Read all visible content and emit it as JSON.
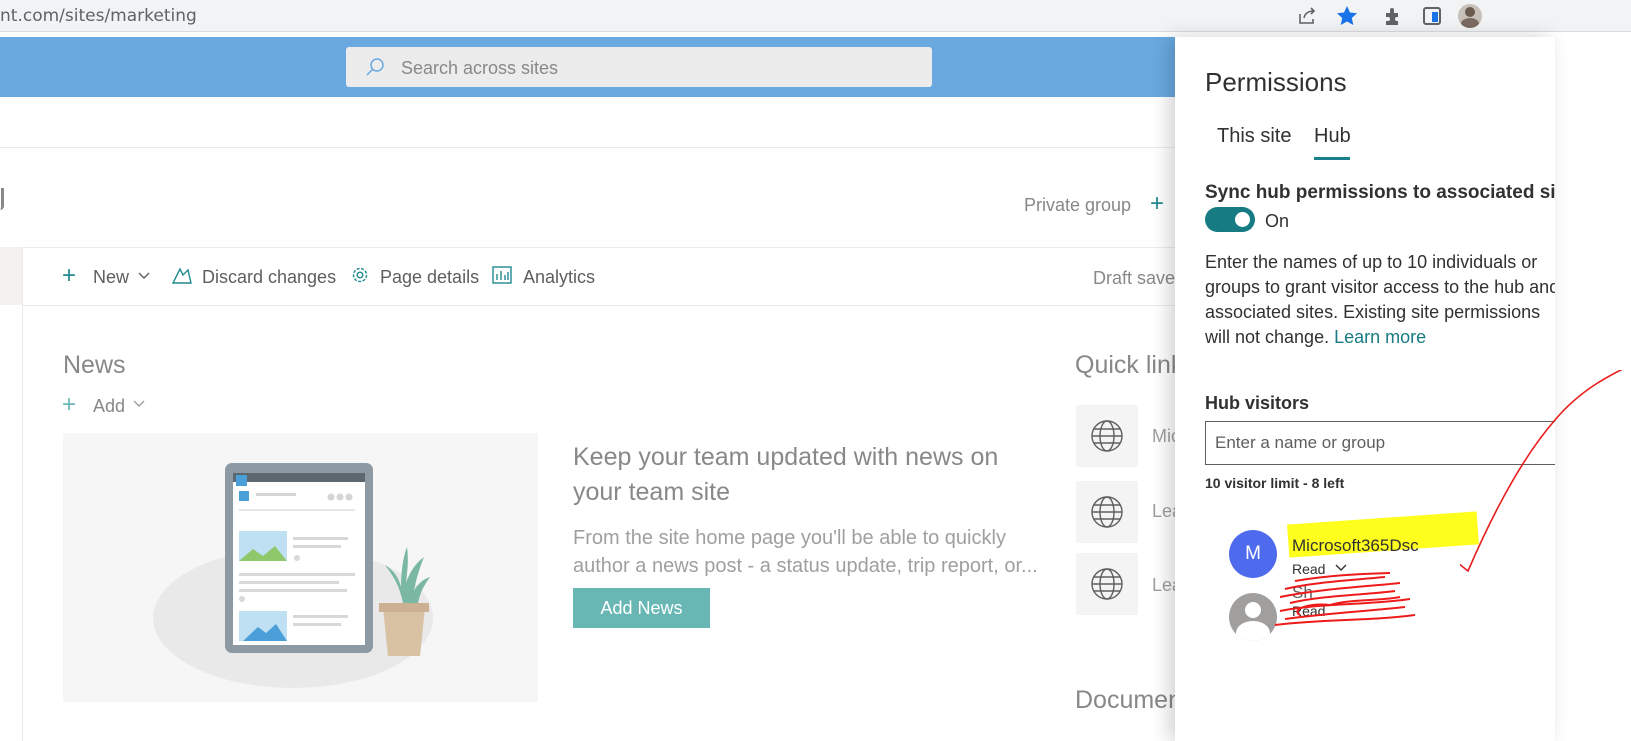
{
  "browser": {
    "url": "nt.com/sites/marketing",
    "icons": [
      "share-icon",
      "star-icon",
      "extensions-icon",
      "sidebar-icon",
      "profile-avatar"
    ]
  },
  "suitebar": {
    "search_placeholder": "Search across sites",
    "color": "#69a9e0"
  },
  "site_header": {
    "private_group": "Private group",
    "plus": "+"
  },
  "commandbar": {
    "new": "New",
    "discard": "Discard changes",
    "page_details": "Page details",
    "analytics": "Analytics",
    "draft": "Draft saved"
  },
  "news": {
    "title": "News",
    "add": "Add",
    "headline": "Keep your team updated with news on your team site",
    "description": "From the site home page you'll be able to quickly author a news post - a status update, trip report, or...",
    "add_news_button": "Add News"
  },
  "quick_links": {
    "title": "Quick links",
    "items": [
      "Mic",
      "Lea",
      "Lea"
    ]
  },
  "documents": {
    "title": "Documents"
  },
  "permissions_panel": {
    "title": "Permissions",
    "tabs": [
      "This site",
      "Hub"
    ],
    "active_tab": "Hub",
    "sync_label": "Sync hub permissions to associated sites",
    "toggle_state": "On",
    "description": "Enter the names of up to 10 individuals or groups to grant visitor access to the hub and associated sites. Existing site permissions will not change.",
    "learn_more": "Learn more",
    "hub_visitors_label": "Hub visitors",
    "name_placeholder": "Enter a name or group",
    "limit_text": "10 visitor limit - 8 left",
    "visitors": [
      {
        "initial": "M",
        "name": "Microsoft365Dsc",
        "role": "Read"
      },
      {
        "initial": "",
        "name": "Sh",
        "role": "Read"
      }
    ],
    "accent": "#167b83"
  }
}
